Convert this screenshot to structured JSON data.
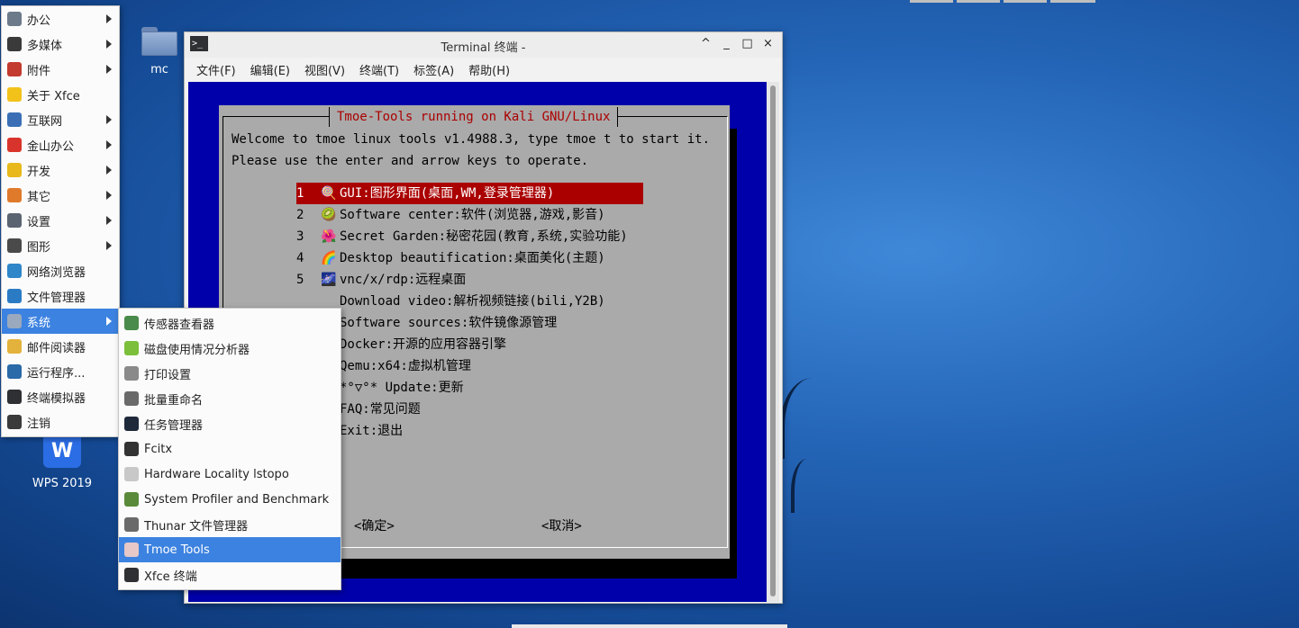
{
  "desktop": {
    "icons": [
      {
        "label": "mc",
        "icon": "folder-icon"
      },
      {
        "label": "WPS 2019",
        "icon": "wps-icon",
        "glyph": "W"
      }
    ]
  },
  "terminal": {
    "title": "Terminal 终端 -",
    "title_icon_glyph": ">_",
    "controls": {
      "shade": "^",
      "minimize": "_",
      "maximize": "□",
      "close": "×"
    },
    "menu": [
      "文件(F)",
      "编辑(E)",
      "视图(V)",
      "终端(T)",
      "标签(A)",
      "帮助(H)"
    ],
    "dialog": {
      "title": "Tmoe-Tools running on Kali GNU/Linux",
      "welcome_line1": "Welcome to tmoe linux tools v1.4988.3, type tmoe t to start it.",
      "welcome_line2": "Please use the enter and arrow keys to operate.",
      "items": [
        {
          "num": "1",
          "emoji": "🍭",
          "text": "GUI:图形界面(桌面,WM,登录管理器)",
          "selected": true
        },
        {
          "num": "2",
          "emoji": "🥝",
          "text": "Software center:软件(浏览器,游戏,影音)"
        },
        {
          "num": "3",
          "emoji": "🌺",
          "text": "Secret Garden:秘密花园(教育,系统,实验功能)"
        },
        {
          "num": "4",
          "emoji": "🌈",
          "text": "Desktop beautification:桌面美化(主题)"
        },
        {
          "num": "5",
          "emoji": "🌌",
          "text": "vnc/x/rdp:远程桌面"
        },
        {
          "num": "",
          "emoji": "",
          "text": "Download video:解析视频链接(bili,Y2B)"
        },
        {
          "num": "",
          "emoji": "",
          "text": "Software sources:软件镜像源管理"
        },
        {
          "num": "",
          "emoji": "",
          "text": "Docker:开源的应用容器引擎"
        },
        {
          "num": "",
          "emoji": "",
          "text": "Qemu:x64:虚拟机管理"
        },
        {
          "num": "",
          "emoji": "",
          "text": "*°▽°* Update:更新"
        },
        {
          "num": "",
          "emoji": "",
          "text": "FAQ:常见问题"
        },
        {
          "num": "",
          "emoji": "",
          "text": "Exit:退出"
        }
      ],
      "ok_button": "<确定>",
      "cancel_button": "<取消>"
    }
  },
  "app_menu": {
    "items": [
      {
        "label": "办公",
        "icon": "office-icon",
        "color": "#6c7a8a",
        "has_submenu": true
      },
      {
        "label": "多媒体",
        "icon": "multimedia-icon",
        "color": "#3a3a3a",
        "has_submenu": true
      },
      {
        "label": "附件",
        "icon": "accessories-icon",
        "color": "#c33a2f",
        "has_submenu": true
      },
      {
        "label": "关于 Xfce",
        "icon": "star-icon",
        "color": "#f2c21b",
        "has_submenu": false
      },
      {
        "label": "互联网",
        "icon": "globe-icon",
        "color": "#3a6fb5",
        "has_submenu": true
      },
      {
        "label": "金山办公",
        "icon": "wps-office-icon",
        "color": "#d9342b",
        "has_submenu": true
      },
      {
        "label": "开发",
        "icon": "development-icon",
        "color": "#e8b81c",
        "has_submenu": true
      },
      {
        "label": "其它",
        "icon": "other-icon",
        "color": "#e07a2b",
        "has_submenu": true
      },
      {
        "label": "设置",
        "icon": "settings-icon",
        "color": "#5a6470",
        "has_submenu": true
      },
      {
        "label": "图形",
        "icon": "graphics-icon",
        "color": "#4a4a4a",
        "has_submenu": true
      },
      {
        "label": "网络浏览器",
        "icon": "web-browser-icon",
        "color": "#2f86c8",
        "has_submenu": false
      },
      {
        "label": "文件管理器",
        "icon": "file-manager-icon",
        "color": "#2b7bc4",
        "has_submenu": false
      },
      {
        "label": "系统",
        "icon": "system-gear-icon",
        "color": "#9aa9bd",
        "has_submenu": true,
        "active": true
      },
      {
        "label": "邮件阅读器",
        "icon": "mail-icon",
        "color": "#e3b23c",
        "has_submenu": false
      },
      {
        "label": "运行程序...",
        "icon": "run-program-icon",
        "color": "#2a6aa8",
        "has_submenu": false
      },
      {
        "label": "终端模拟器",
        "icon": "terminal-icon",
        "color": "#2f3033",
        "has_submenu": false
      },
      {
        "label": "注销",
        "icon": "logout-icon",
        "color": "#3a3a3a",
        "has_submenu": false
      }
    ]
  },
  "system_submenu": {
    "items": [
      {
        "label": "传感器查看器",
        "icon": "sensor-icon",
        "color": "#4a8a4a"
      },
      {
        "label": "磁盘使用情况分析器",
        "icon": "disk-usage-icon",
        "color": "#7bbf3a"
      },
      {
        "label": "打印设置",
        "icon": "printer-icon",
        "color": "#8a8a8a"
      },
      {
        "label": "批量重命名",
        "icon": "bulk-rename-icon",
        "color": "#6a6a6a"
      },
      {
        "label": "任务管理器",
        "icon": "task-manager-icon",
        "color": "#1e2a3a"
      },
      {
        "label": "Fcitx",
        "icon": "penguin-icon",
        "color": "#333333"
      },
      {
        "label": "Hardware Locality lstopo",
        "icon": "lstopo-icon",
        "color": "#c8c8c8"
      },
      {
        "label": "System Profiler and Benchmark",
        "icon": "profiler-icon",
        "color": "#5a8a3a"
      },
      {
        "label": "Thunar 文件管理器",
        "icon": "thunar-icon",
        "color": "#6a6a6a"
      },
      {
        "label": "Tmoe Tools",
        "icon": "tmoe-icon",
        "color": "#e6c8c8",
        "active": true
      },
      {
        "label": "Xfce 终端",
        "icon": "xfce-terminal-icon",
        "color": "#2f3033"
      }
    ]
  }
}
